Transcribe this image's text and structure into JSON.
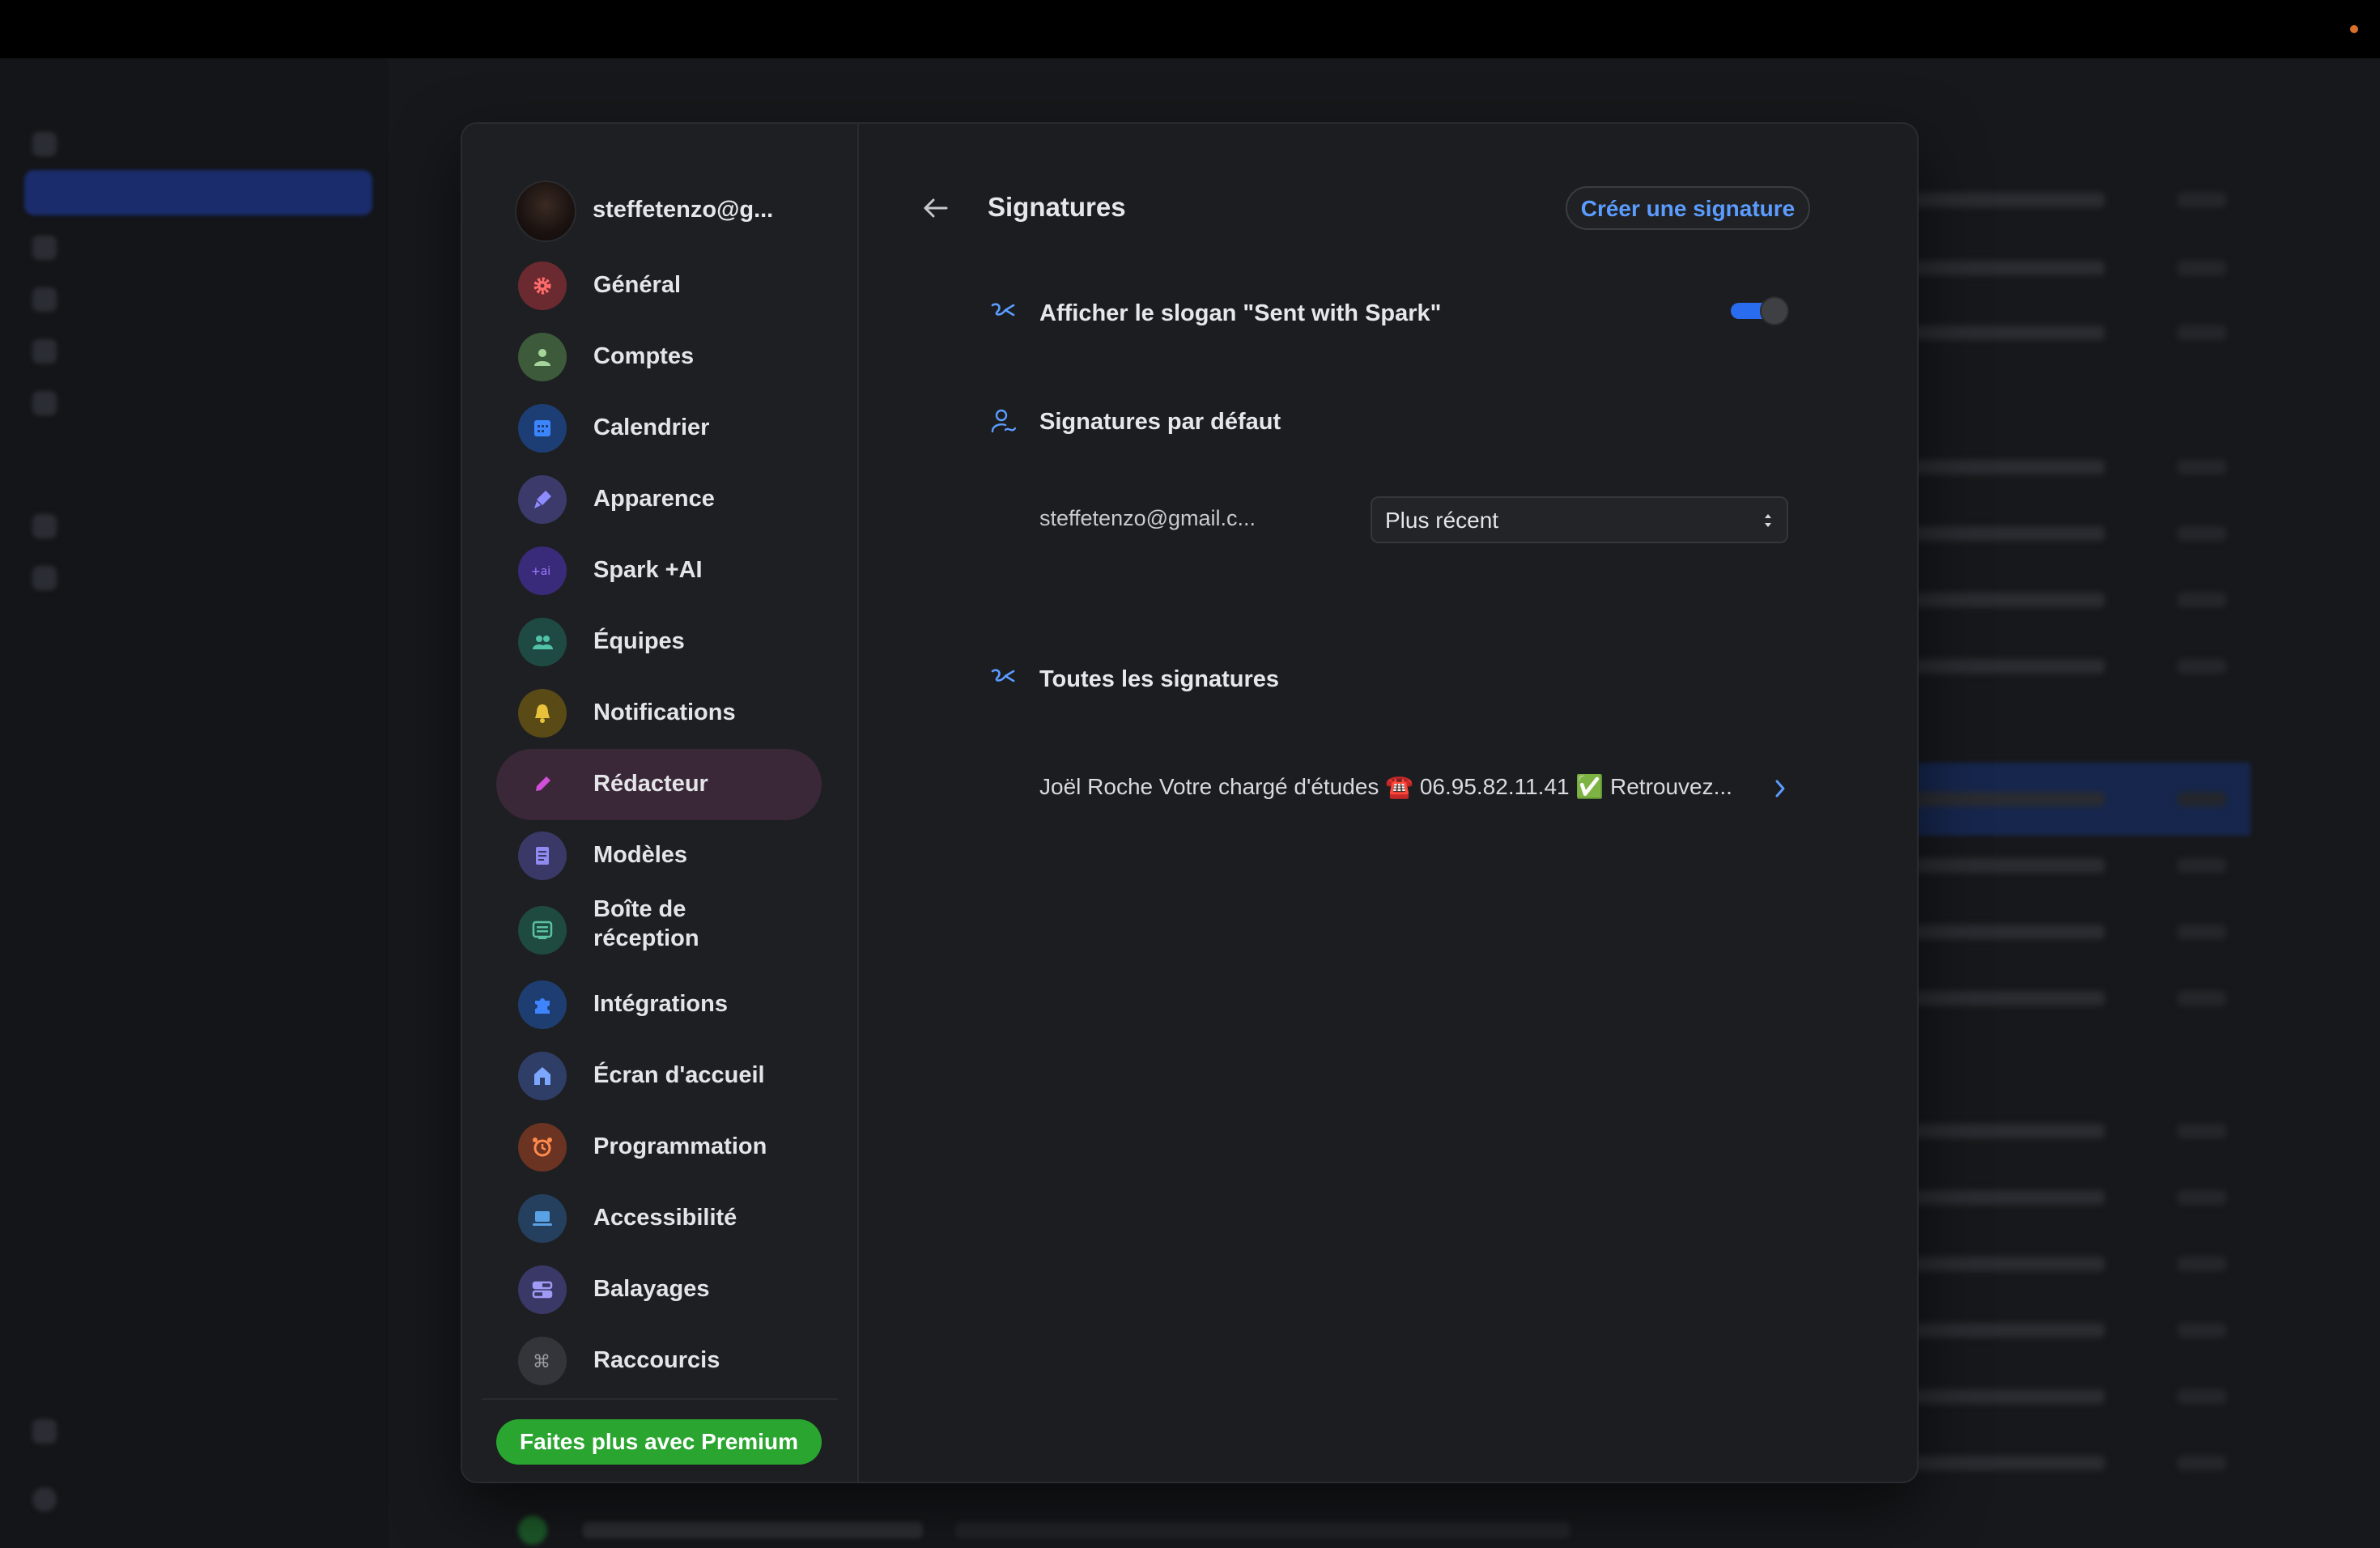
{
  "colors": {
    "accent": "#5b9cff",
    "toggle_on": "#2a6cf0",
    "premium": "#2aa52f",
    "active_item": "#3a2838",
    "close": "#ff4a3d"
  },
  "sidebar": {
    "account_name": "steffetenzo@g...",
    "items": [
      {
        "label": "Général",
        "icon": "gear-icon",
        "color": "#6b2a30",
        "fg": "#ff6b6b"
      },
      {
        "label": "Comptes",
        "icon": "person-icon",
        "color": "#3d5a3a",
        "fg": "#a6d59b"
      },
      {
        "label": "Calendrier",
        "icon": "calendar-icon",
        "color": "#1d3e75",
        "fg": "#3b86ff"
      },
      {
        "label": "Apparence",
        "icon": "brush-icon",
        "color": "#3b3a6b",
        "fg": "#8f8cff"
      },
      {
        "label": "Spark +AI",
        "icon": "ai-icon",
        "color": "#3a2a7a",
        "fg": "#9b7bff"
      },
      {
        "label": "Équipes",
        "icon": "team-icon",
        "color": "#1f4a44",
        "fg": "#52c2a8"
      },
      {
        "label": "Notifications",
        "icon": "bell-icon",
        "color": "#5a4a16",
        "fg": "#e8c23a"
      },
      {
        "label": "Rédacteur",
        "icon": "pen-icon",
        "color": "#3a2838",
        "fg": "#d04fd8",
        "active": true
      },
      {
        "label": "Modèles",
        "icon": "document-icon",
        "color": "#3a3866",
        "fg": "#8f89f0"
      },
      {
        "label": "Boîte de réception",
        "icon": "inbox-icon",
        "color": "#1f4a40",
        "fg": "#5ac2a2"
      },
      {
        "label": "Intégrations",
        "icon": "puzzle-icon",
        "color": "#1e3e72",
        "fg": "#3e84ff"
      },
      {
        "label": "Écran d'accueil",
        "icon": "home-icon",
        "color": "#2e3e66",
        "fg": "#7da6ff"
      },
      {
        "label": "Programmation",
        "icon": "alarm-clock-icon",
        "color": "#6a3322",
        "fg": "#ff8a4c"
      },
      {
        "label": "Accessibilité",
        "icon": "laptop-icon",
        "color": "#25405e",
        "fg": "#5aa2e6"
      },
      {
        "label": "Balayages",
        "icon": "swipe-icon",
        "color": "#3a3866",
        "fg": "#a09bf5"
      },
      {
        "label": "Raccourcis",
        "icon": "command-icon",
        "color": "#34353a",
        "fg": "#9a9ca3"
      }
    ],
    "premium_label": "Faites plus avec Premium"
  },
  "main": {
    "title": "Signatures",
    "create_button": "Créer une signature",
    "slogan_label": "Afficher le slogan \"Sent with Spark\"",
    "slogan_enabled": true,
    "default_section": "Signatures par défaut",
    "default_account": "steffetenzo@gmail.c...",
    "default_select": "Plus récent",
    "all_section": "Toutes les signatures",
    "signature_preview": "Joël Roche Votre chargé d'études ☎️ 06.95.82.11.41 ✅ Retrouvez..."
  }
}
